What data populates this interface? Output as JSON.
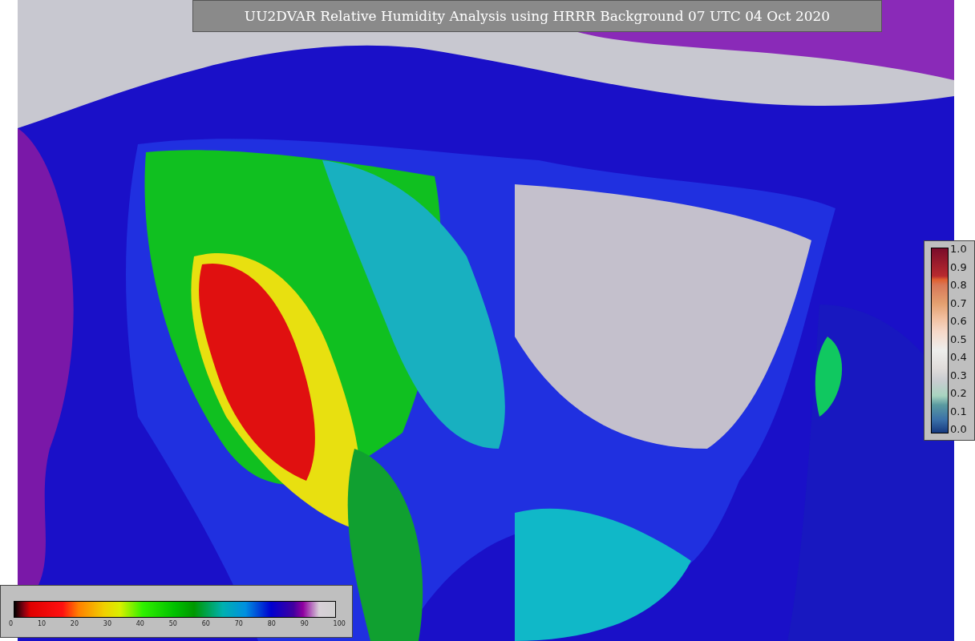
{
  "title": "UU2DVAR Relative Humidity Analysis using HRRR Background 07 UTC 04 Oct 2020",
  "right_colorbar": {
    "ticks": [
      "1.0",
      "0.9",
      "0.8",
      "0.7",
      "0.6",
      "0.5",
      "0.4",
      "0.3",
      "0.2",
      "0.1",
      "0.0"
    ]
  },
  "bottom_colorbar": {
    "ticks": [
      "0",
      "10",
      "20",
      "30",
      "40",
      "50",
      "60",
      "70",
      "80",
      "90",
      "100"
    ]
  }
}
